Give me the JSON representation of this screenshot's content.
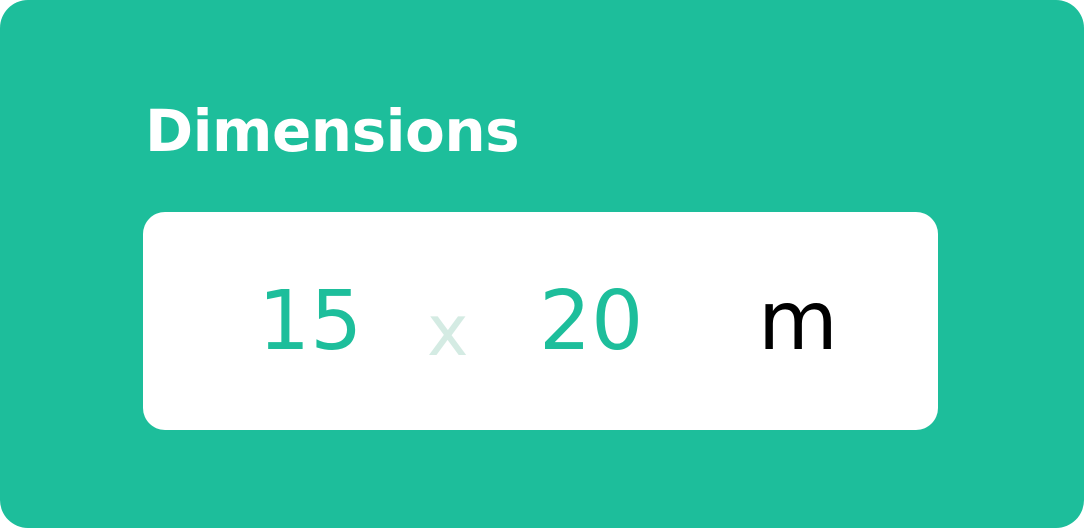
{
  "colors": {
    "card_background": "#1dbe9b",
    "field_background": "#ffffff",
    "value_color": "#1dbe9b",
    "separator_color": "#d4ebe3",
    "unit_color": "#000000"
  },
  "dimensions": {
    "title": "Dimensions",
    "width": "15",
    "separator": "x",
    "height": "20",
    "unit": "m"
  }
}
